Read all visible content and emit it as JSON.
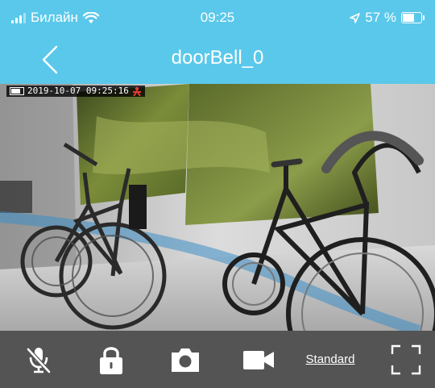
{
  "status_bar": {
    "carrier": "Билайн",
    "time": "09:25",
    "battery": "57 %"
  },
  "nav": {
    "title": "doorBell_0",
    "back_icon": "chevron-left-icon"
  },
  "video": {
    "timestamp": "2019-10-07 09:25:16",
    "scene": "camera view of bicycles in a room"
  },
  "toolbar": {
    "mic_icon": "mic-off-icon",
    "lock_icon": "lock-icon",
    "snapshot_icon": "camera-icon",
    "record_icon": "video-camera-icon",
    "quality_label": "Standard",
    "fullscreen_icon": "fullscreen-icon"
  },
  "colors": {
    "header": "#5ac8ea",
    "toolbar": "#545454",
    "text": "#ffffff"
  }
}
